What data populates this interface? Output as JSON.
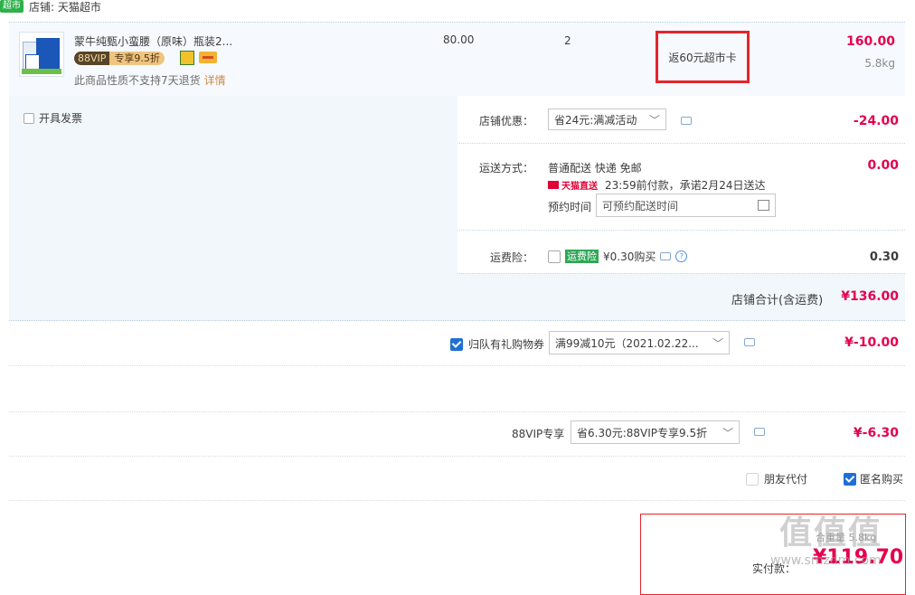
{
  "shop": {
    "badge": "超市",
    "name": "店铺: 天猫超市"
  },
  "item": {
    "title": "蒙牛纯甄小蛮腰（原味）瓶装2...",
    "vip_88": "88VIP",
    "vip_discount": "专享9.5折",
    "return_note": "此商品性质不支持7天退货",
    "details_link": "详情",
    "unit_price": "80.00",
    "quantity": "2",
    "rebate": "返60元超市卡",
    "total": "160.00",
    "weight": "5.8kg"
  },
  "invoice": {
    "label": "开具发票"
  },
  "store_discount": {
    "label": "店铺优惠：",
    "selected": "省24元:满减活动",
    "amount": "-24.00"
  },
  "shipping": {
    "label": "运送方式：",
    "method": "普通配送 快递 免邮",
    "tmall_direct": "天猫直送",
    "promise": "23:59前付款，承诺2月24日送达",
    "schedule_label": "预约时间",
    "schedule_placeholder": "可预约配送时间",
    "amount": "0.00"
  },
  "insurance": {
    "label": "运费险：",
    "badge": "运费险",
    "price": "¥0.30购买",
    "amount": "0.30"
  },
  "store_total": {
    "label": "店铺合计(含运费)",
    "amount": "¥136.00"
  },
  "coupon": {
    "label": "归队有礼购物券",
    "selected": "满99减10元（2021.02.22...",
    "amount": "¥-10.00"
  },
  "vip": {
    "label": "88VIP专享",
    "selected": "省6.30元:88VIP专享9.5折",
    "amount": "¥-6.30"
  },
  "options": {
    "friend_pay": "朋友代付",
    "anonymous": "匿名购买"
  },
  "payment": {
    "label": "实付款：",
    "amount": "¥119.70",
    "hint": "合重量 5.8kg"
  },
  "watermark": {
    "logo": "值值值",
    "site": "www.smzdm.com"
  }
}
